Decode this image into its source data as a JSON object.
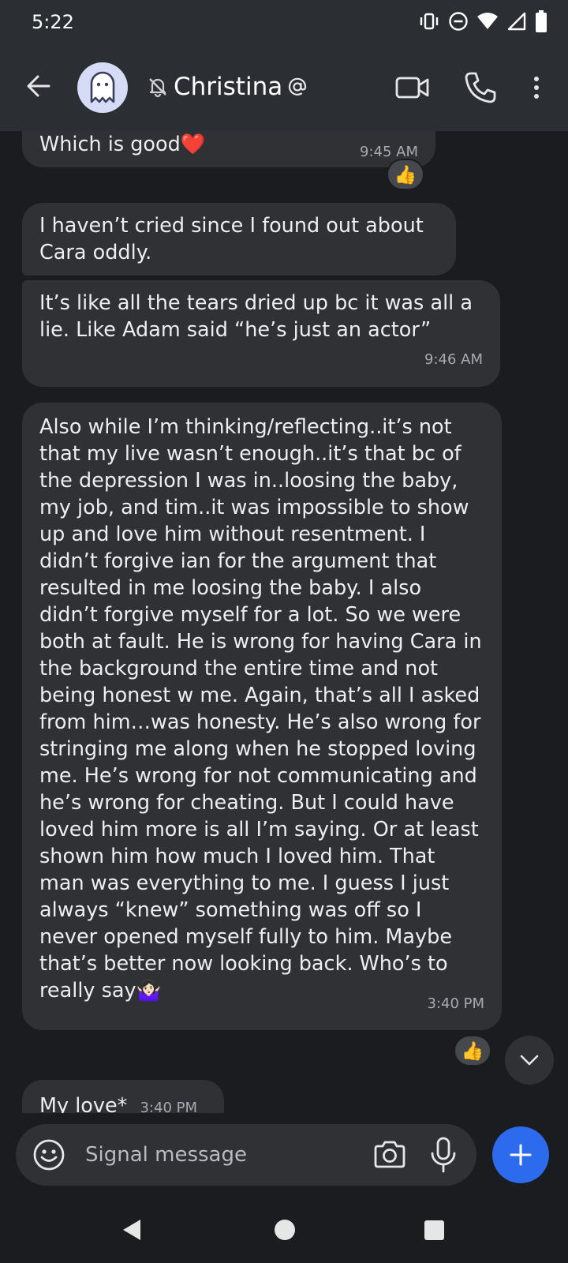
{
  "status_bar": {
    "time": "5:22",
    "icons": [
      "vibrate-icon",
      "do-not-disturb-icon",
      "wifi-icon",
      "cellular-signal-icon",
      "battery-icon"
    ]
  },
  "header": {
    "contact_name": "Christina",
    "muted": true,
    "icons": [
      "back-arrow-icon",
      "ghost-avatar-icon",
      "bell-off-icon",
      "at-sign-icon",
      "video-camera-icon",
      "phone-icon",
      "more-vertical-icon"
    ]
  },
  "messages": [
    {
      "text": "Which is good❤️",
      "time": "9:45 AM",
      "reaction": "👍"
    },
    {
      "text": "I haven’t cried since I found out about Cara oddly.",
      "time": ""
    },
    {
      "text": "It’s like all the tears dried up bc it was all a lie. Like Adam said “he’s just an actor”",
      "time": "9:46 AM"
    },
    {
      "text": "Also while I’m thinking/reflecting..it’s not that my live wasn’t enough..it’s that bc of the depression I was in..loosing the baby, my job, and tim..it was impossible to show up and love him without resentment. I didn’t forgive ian for the argument that resulted in me loosing the baby. I also didn’t forgive myself for a lot. So we were both at fault. He is wrong for having Cara in the background the entire time and not being honest w me. Again, that’s all I asked from him…was honesty. He’s also wrong for stringing me along when he stopped loving me. He’s wrong for not communicating and he’s wrong for cheating. But I could have loved him more is all I’m saying. Or at least shown him how much I loved him. That man was everything to me. I guess I just always “knew” something was off so I never opened myself fully to him. Maybe that’s better now looking back. Who’s to really say🤷🏻‍♀️",
      "time": "3:40 PM",
      "reaction": "👍"
    },
    {
      "text": "My love*",
      "time": "3:40 PM"
    }
  ],
  "composer": {
    "placeholder": "Signal message",
    "icons": [
      "emoji-icon",
      "camera-icon",
      "microphone-icon",
      "plus-icon"
    ]
  },
  "nav_bar": {
    "icons": [
      "nav-back-icon",
      "nav-home-icon",
      "nav-recents-icon"
    ]
  },
  "colors": {
    "background": "#1b1c1f",
    "app_bar": "#2b2e33",
    "bubble": "#303134",
    "accent": "#2c6bed"
  }
}
